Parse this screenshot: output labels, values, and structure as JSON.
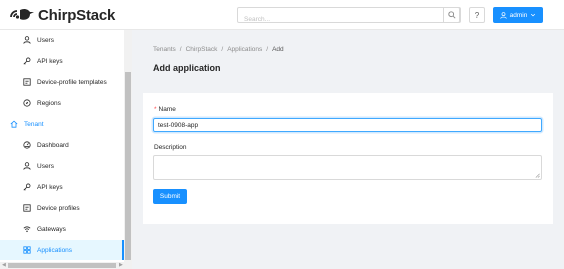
{
  "header": {
    "logo_text": "ChirpStack",
    "search_placeholder": "Search...",
    "help_label": "?",
    "user_label": "admin"
  },
  "sidebar": {
    "items": [
      {
        "label": "Users",
        "icon": "user-icon"
      },
      {
        "label": "API keys",
        "icon": "key-icon"
      },
      {
        "label": "Device-profile templates",
        "icon": "profile-icon"
      },
      {
        "label": "Regions",
        "icon": "compass-icon"
      },
      {
        "label": "Tenant",
        "icon": "home-icon"
      },
      {
        "label": "Dashboard",
        "icon": "dashboard-icon"
      },
      {
        "label": "Users",
        "icon": "user-icon"
      },
      {
        "label": "API keys",
        "icon": "key-icon"
      },
      {
        "label": "Device profiles",
        "icon": "profile-icon"
      },
      {
        "label": "Gateways",
        "icon": "wifi-icon"
      },
      {
        "label": "Applications",
        "icon": "app-icon"
      }
    ]
  },
  "breadcrumb": [
    "Tenants",
    "ChirpStack",
    "Applications",
    "Add"
  ],
  "page": {
    "title": "Add application"
  },
  "form": {
    "name_label": "Name",
    "name_required_mark": "*",
    "name_value": "test-0908-app",
    "description_label": "Description",
    "description_value": "",
    "submit_label": "Submit"
  },
  "colors": {
    "accent": "#1890ff",
    "active_bg": "#e6f7ff",
    "page_bg": "#f0f2f5"
  }
}
